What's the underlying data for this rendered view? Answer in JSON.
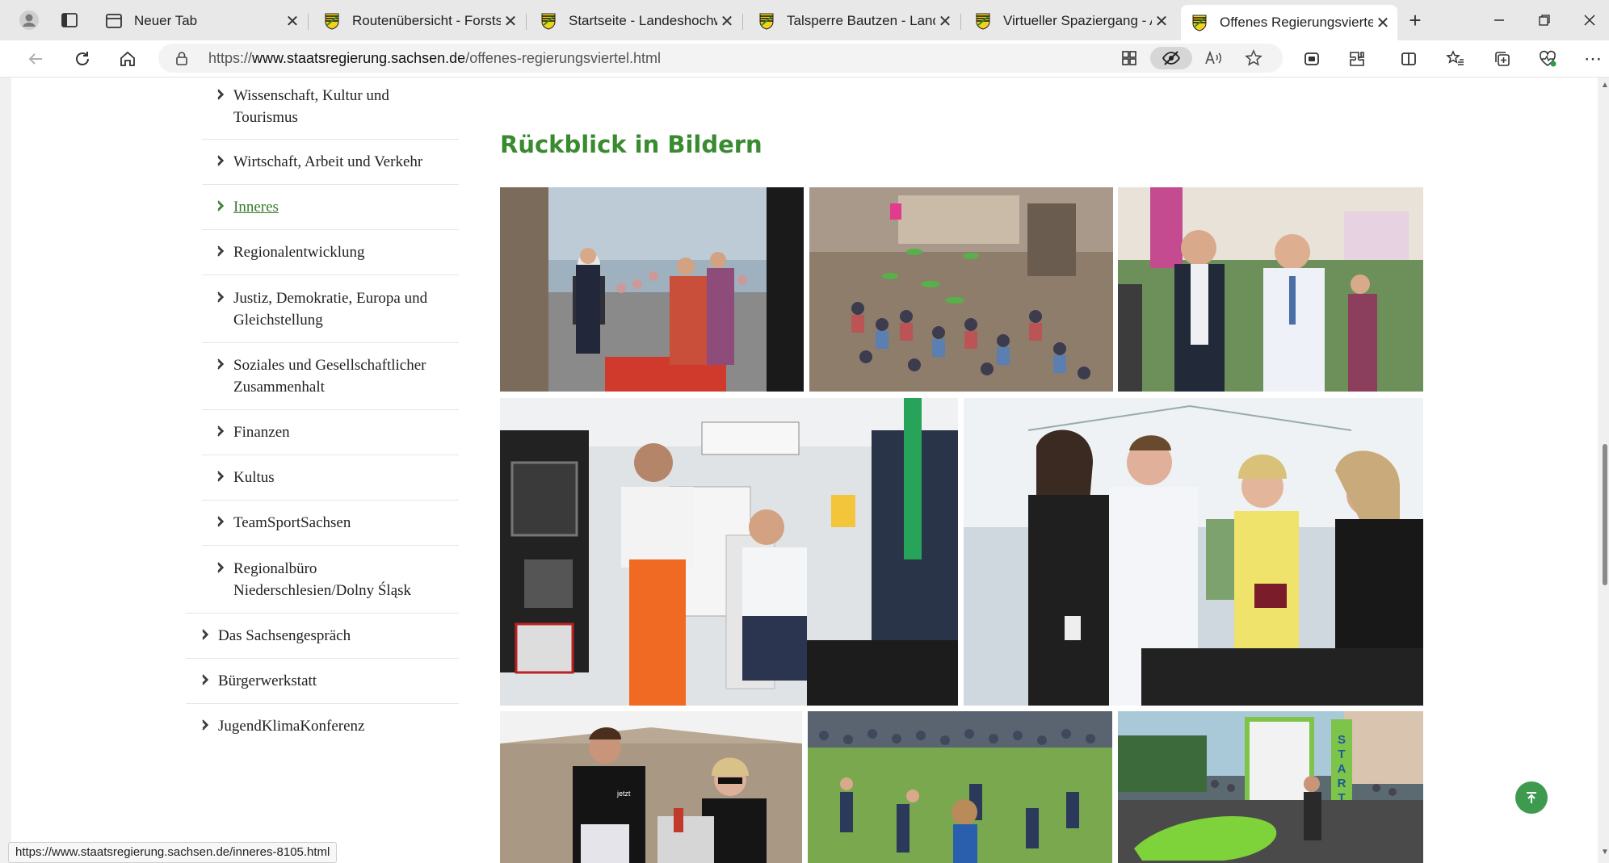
{
  "browser": {
    "tabs": [
      {
        "title": "Neuer Tab",
        "active": false
      },
      {
        "title": "Routenübersicht - Forststeig",
        "active": false
      },
      {
        "title": "Startseite - Landeshochwasserzentrum",
        "active": false
      },
      {
        "title": "Talsperre Bautzen - Landestalsperrenverwaltung",
        "active": false
      },
      {
        "title": "Virtueller Spaziergang - Archiv",
        "active": false
      },
      {
        "title": "Offenes Regierungsviertel",
        "active": true
      }
    ],
    "address": {
      "prefix": "https://",
      "host": "www.staatsregierung.sachsen.de",
      "path": "/offenes-regierungsviertel.html"
    },
    "status_url": "https://www.staatsregierung.sachsen.de/inneres-8105.html"
  },
  "sidebar": {
    "sub_items": [
      {
        "label_lines": [
          "Wissenschaft, Kultur und",
          "Tourismus"
        ],
        "active": false
      },
      {
        "label_lines": [
          "Wirtschaft, Arbeit und Verkehr"
        ],
        "active": false
      },
      {
        "label_lines": [
          "Inneres"
        ],
        "active": true
      },
      {
        "label_lines": [
          "Regionalentwicklung"
        ],
        "active": false
      },
      {
        "label_lines": [
          "Justiz, Demokratie, Europa und",
          "Gleichstellung"
        ],
        "active": false
      },
      {
        "label_lines": [
          "Soziales und Gesellschaftlicher",
          "Zusammenhalt"
        ],
        "active": false
      },
      {
        "label_lines": [
          "Finanzen"
        ],
        "active": false
      },
      {
        "label_lines": [
          "Kultus"
        ],
        "active": false
      },
      {
        "label_lines": [
          "TeamSportSachsen"
        ],
        "active": false
      },
      {
        "label_lines": [
          "Regionalbüro",
          "Niederschlesien/Dolny Śląsk"
        ],
        "active": false
      }
    ],
    "top_items": [
      {
        "label": "Das Sachsengespräch"
      },
      {
        "label": "Bürgerwerkstatt"
      },
      {
        "label": "JugendKlimaKonferenz"
      }
    ]
  },
  "main": {
    "heading": "Rückblick in Bildern",
    "photos": [
      {
        "id": "photo-1"
      },
      {
        "id": "photo-2"
      },
      {
        "id": "photo-3"
      },
      {
        "id": "photo-4"
      },
      {
        "id": "photo-5"
      },
      {
        "id": "photo-6",
        "shirt_text": "jetzt"
      },
      {
        "id": "photo-7"
      },
      {
        "id": "photo-8",
        "banner_text": "START"
      }
    ]
  },
  "colors": {
    "heading_green": "#3a8a30",
    "active_link_green": "#3a7a2c",
    "to_top_green": "#3e9a4e"
  },
  "icons": {
    "profile": "profile-icon",
    "tab_actions": "tab-actions-icon",
    "back": "back-arrow-icon",
    "reload": "reload-icon",
    "home": "home-icon",
    "lock": "lock-icon",
    "to_top": "scroll-to-top-icon"
  }
}
